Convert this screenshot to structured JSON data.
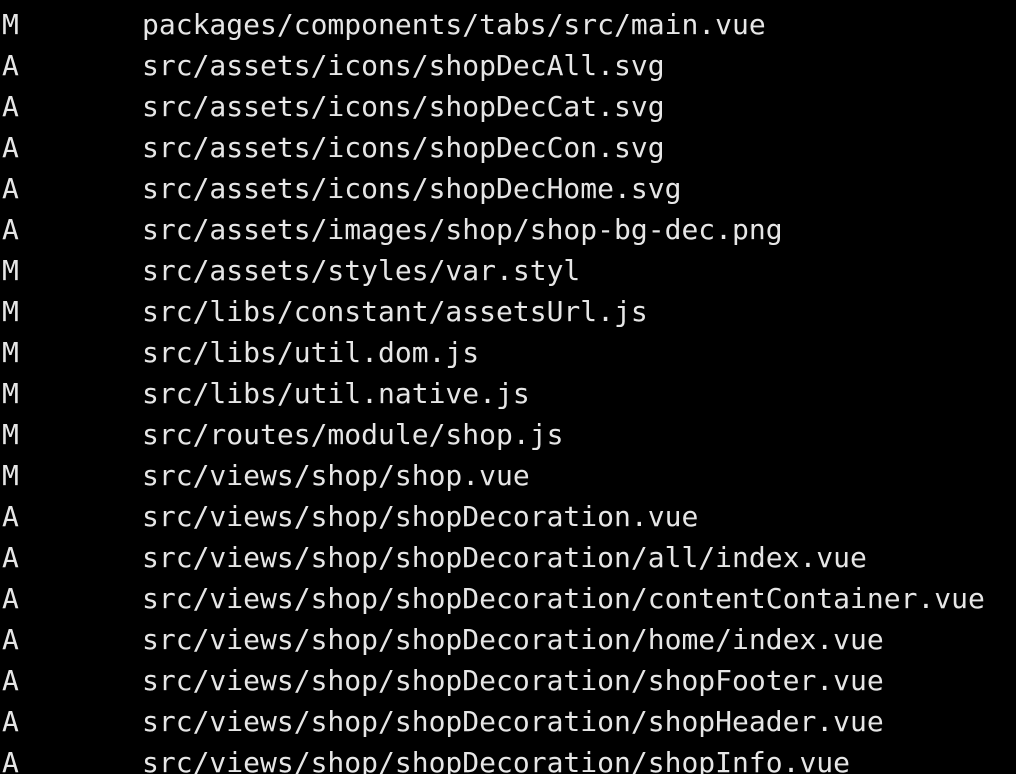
{
  "terminal": {
    "background": "#000000",
    "foreground": "#e6e6e6",
    "lines": [
      {
        "status": "M",
        "path": "packages/components/tabs/src/main.vue"
      },
      {
        "status": "A",
        "path": "src/assets/icons/shopDecAll.svg"
      },
      {
        "status": "A",
        "path": "src/assets/icons/shopDecCat.svg"
      },
      {
        "status": "A",
        "path": "src/assets/icons/shopDecCon.svg"
      },
      {
        "status": "A",
        "path": "src/assets/icons/shopDecHome.svg"
      },
      {
        "status": "A",
        "path": "src/assets/images/shop/shop-bg-dec.png"
      },
      {
        "status": "M",
        "path": "src/assets/styles/var.styl"
      },
      {
        "status": "M",
        "path": "src/libs/constant/assetsUrl.js"
      },
      {
        "status": "M",
        "path": "src/libs/util.dom.js"
      },
      {
        "status": "M",
        "path": "src/libs/util.native.js"
      },
      {
        "status": "M",
        "path": "src/routes/module/shop.js"
      },
      {
        "status": "M",
        "path": "src/views/shop/shop.vue"
      },
      {
        "status": "A",
        "path": "src/views/shop/shopDecoration.vue"
      },
      {
        "status": "A",
        "path": "src/views/shop/shopDecoration/all/index.vue"
      },
      {
        "status": "A",
        "path": "src/views/shop/shopDecoration/contentContainer.vue"
      },
      {
        "status": "A",
        "path": "src/views/shop/shopDecoration/home/index.vue"
      },
      {
        "status": "A",
        "path": "src/views/shop/shopDecoration/shopFooter.vue"
      },
      {
        "status": "A",
        "path": "src/views/shop/shopDecoration/shopHeader.vue"
      },
      {
        "status": "A",
        "path": "src/views/shop/shopDecoration/shopInfo.vue"
      }
    ]
  }
}
